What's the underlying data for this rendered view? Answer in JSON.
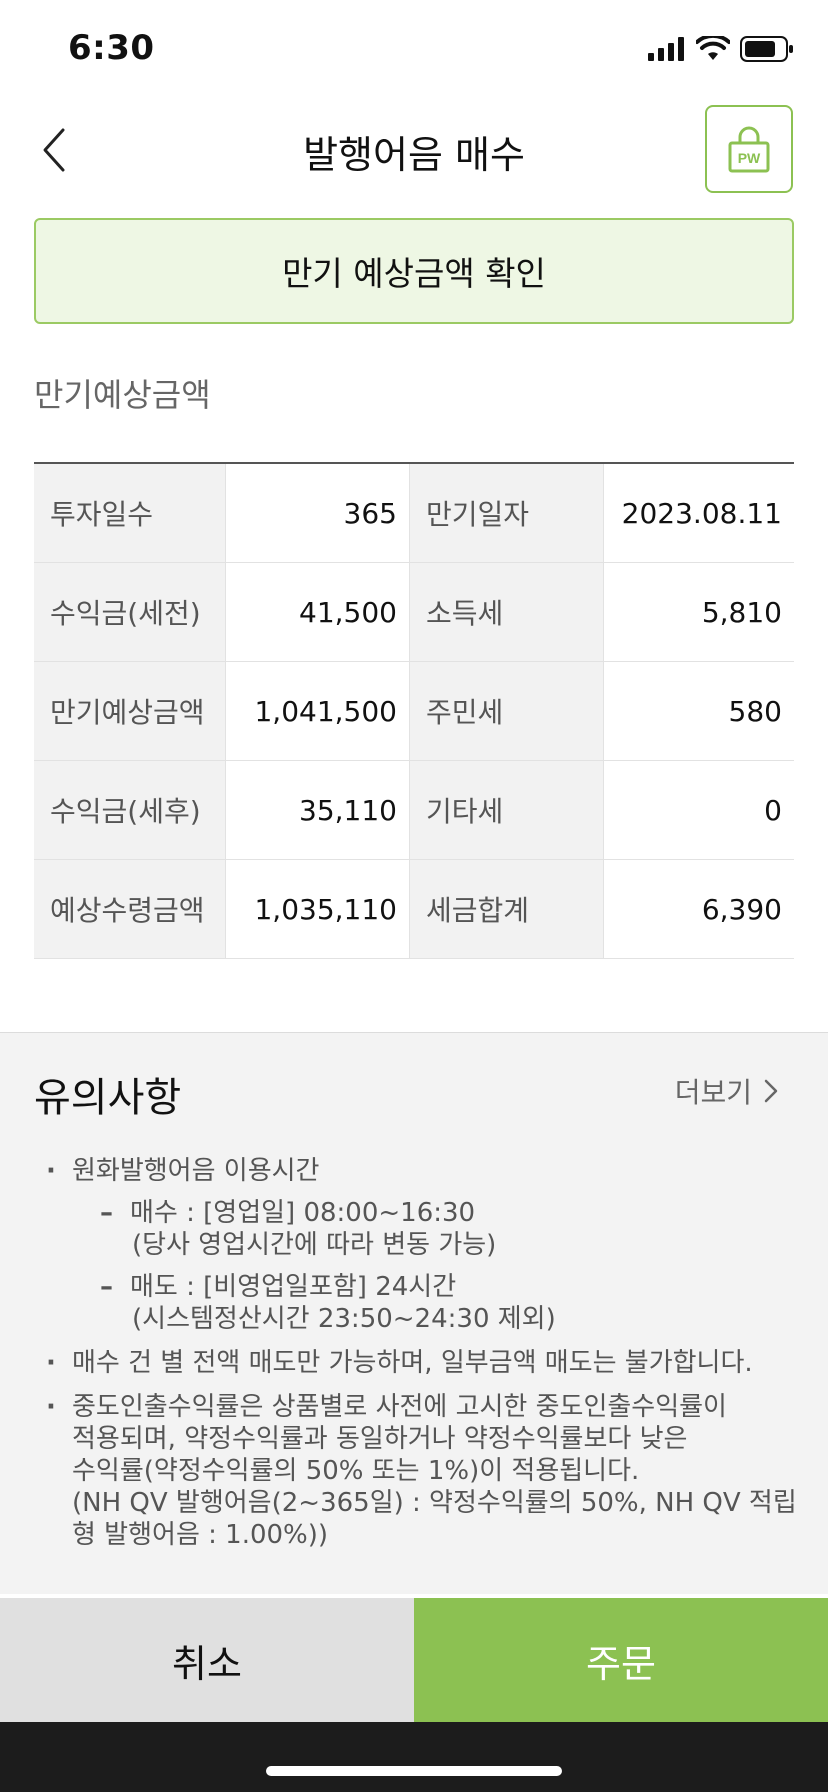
{
  "status_bar": {
    "time": "6:30"
  },
  "header": {
    "title": "발행어음 매수",
    "pw_label": "PW"
  },
  "banner": {
    "text": "만기 예상금액 확인"
  },
  "section": {
    "title": "만기예상금액"
  },
  "table": {
    "rows": [
      {
        "label1": "투자일수",
        "value1": "365",
        "label2": "만기일자",
        "value2": "2023.08.11"
      },
      {
        "label1": "수익금(세전)",
        "value1": "41,500",
        "label2": "소득세",
        "value2": "5,810"
      },
      {
        "label1": "만기예상금액",
        "value1": "1,041,500",
        "label2": "주민세",
        "value2": "580"
      },
      {
        "label1": "수익금(세후)",
        "value1": "35,110",
        "label2": "기타세",
        "value2": "0"
      },
      {
        "label1": "예상수령금액",
        "value1": "1,035,110",
        "label2": "세금합계",
        "value2": "6,390"
      }
    ]
  },
  "notice": {
    "title": "유의사항",
    "more": "더보기",
    "item1": "원화발행어음 이용시간",
    "buy_line1": "매수 : [영업일] 08:00~16:30",
    "buy_line2": "(당사 영업시간에 따라 변동 가능)",
    "sell_line1": "매도 : [비영업일포함] 24시간",
    "sell_line2": "(시스템정산시간 23:50~24:30 제외)",
    "item2": "매수 건 별 전액 매도만 가능하며, 일부금액 매도는 불가합니다.",
    "item3_line1": "중도인출수익률은 상품별로 사전에 고시한 중도인출수익률이",
    "item3_line2": "적용되며, 약정수익률과 동일하거나 약정수익률보다 낮은",
    "item3_line3": "수익률(약정수익률의 50% 또는 1%)이 적용됩니다.",
    "item3_line4": "(NH QV 발행어음(2~365일) : 약정수익률의 50%, NH QV 적립",
    "item3_line5": "형 발행어음 : 1.00%))"
  },
  "buttons": {
    "cancel": "취소",
    "order": "주문"
  },
  "colors": {
    "accent": "#8cc152",
    "banner_bg": "#eef7e4",
    "notice_bg": "#f3f3f3"
  }
}
